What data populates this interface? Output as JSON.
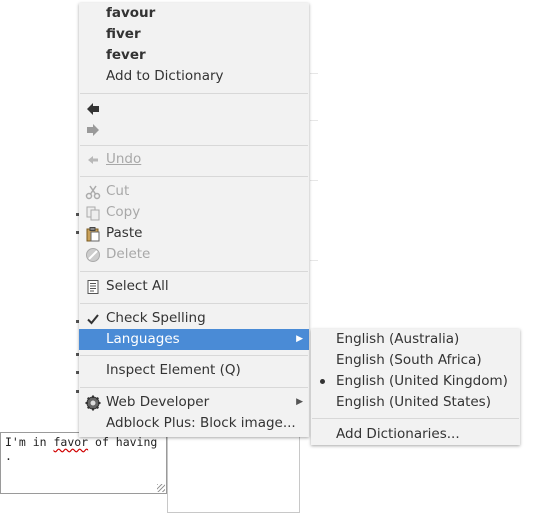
{
  "context_menu": {
    "suggestions": [
      "favour",
      "fiver",
      "fever"
    ],
    "add_to_dictionary": "Add to Dictionary",
    "undo": "Undo",
    "cut": "Cut",
    "copy": "Copy",
    "paste": "Paste",
    "delete": "Delete",
    "select_all": "Select All",
    "check_spelling": "Check Spelling",
    "languages": "Languages",
    "inspect_element": "Inspect Element (Q)",
    "web_developer": "Web Developer",
    "adblock": "Adblock Plus: Block image..."
  },
  "languages_menu": {
    "items": [
      {
        "label": "English (Australia)",
        "selected": false
      },
      {
        "label": "English (South Africa)",
        "selected": false
      },
      {
        "label": "English (United Kingdom)",
        "selected": true
      },
      {
        "label": "English (United States)",
        "selected": false
      }
    ],
    "add_dictionaries": "Add Dictionaries..."
  },
  "textbox": {
    "line1_prefix": "I'm in ",
    "line1_misspelled": "favor",
    "line1_suffix": " of having",
    "line2": "."
  },
  "colors": {
    "highlight": "#4a8bd6",
    "menu_bg": "#f2f2f2",
    "disabled_text": "#a8a8a8",
    "spelling_underline": "#d00000"
  },
  "icons": {
    "back": "back-arrow-icon",
    "forward": "forward-arrow-icon",
    "undo": "undo-icon",
    "cut": "scissors-icon",
    "copy": "copy-icon",
    "paste": "clipboard-icon",
    "delete": "delete-icon",
    "select_all": "select-all-icon",
    "check": "checkmark-icon",
    "web_developer": "gear-icon"
  }
}
